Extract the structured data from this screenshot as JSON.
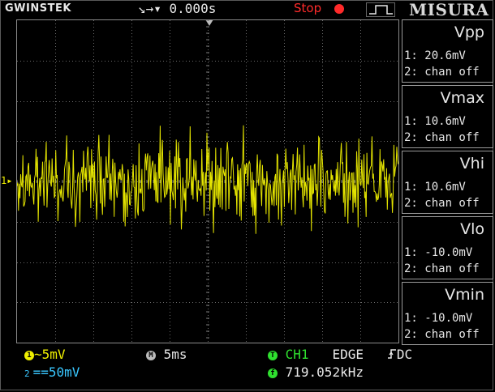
{
  "header": {
    "brand": "GWINSTEK",
    "trigger_delay": "↘→▾ 0.000s",
    "run_state": "Stop",
    "panel_title": "MISURA"
  },
  "channel1": {
    "marker": "1▸",
    "coupling_scale": "~5mV",
    "color": "#f0f000"
  },
  "channel2": {
    "coupling_scale": "==50mV",
    "badge": "2",
    "color": "#39c7ff"
  },
  "timebase": {
    "badge": "M",
    "value": "5ms"
  },
  "trigger": {
    "badge": "T",
    "source": "CH1",
    "type": "EDGE",
    "coupling": "DC",
    "slope_icon": "rising-edge-icon"
  },
  "frequency": {
    "badge": "f",
    "value": "719.052kHz"
  },
  "measurements": [
    {
      "title": "Vpp",
      "ch1": "1: 20.6mV",
      "ch2": "2: chan off"
    },
    {
      "title": "Vmax",
      "ch1": "1: 10.6mV",
      "ch2": "2: chan off"
    },
    {
      "title": "Vhi",
      "ch1": "1: 10.6mV",
      "ch2": "2: chan off"
    },
    {
      "title": "Vlo",
      "ch1": "1: -10.0mV",
      "ch2": "2: chan off"
    },
    {
      "title": "Vmin",
      "ch1": "1: -10.0mV",
      "ch2": "2: chan off"
    }
  ]
}
